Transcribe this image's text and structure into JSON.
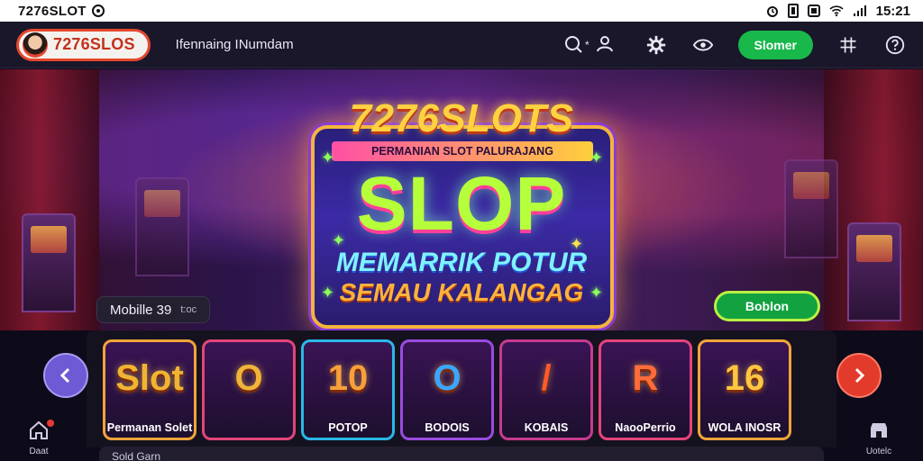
{
  "status_bar": {
    "app_title": "7276SLOT",
    "icons": [
      "alarm-icon",
      "battery-icon",
      "app-icon",
      "wifi-icon",
      "signal-icon"
    ],
    "time": "15:21"
  },
  "header": {
    "brand": "7276SLOS",
    "subtitle": "Ifennaing INumdam",
    "action_button": "Slomer",
    "icons": [
      "search-users-icon",
      "settings-icon",
      "eye-icon",
      "grid-icon",
      "help-icon"
    ]
  },
  "hero": {
    "sign_brand": "7276SLOTS",
    "sign_ribbon": "PERMANIAN SLOT PALURAJANG",
    "sign_main": "SLOP",
    "sign_line1": "MEMARRIK POTUR",
    "sign_line2": "SEMAU KALANGAG",
    "chip_label": "Mobille 39",
    "chip_sub": "t:oc",
    "cta_label": "Boblon"
  },
  "games": [
    {
      "label": "Permanan Solet",
      "art": "Slot",
      "accent": "#f1b431"
    },
    {
      "label": "",
      "art": "O",
      "accent": "#f0b43a"
    },
    {
      "label": "POTOP",
      "art": "10",
      "accent": "#f6a03b"
    },
    {
      "label": "BODOIS",
      "art": "O",
      "accent": "#3aa6ff"
    },
    {
      "label": "KOBAIS",
      "art": "/",
      "accent": "#ff5a2b"
    },
    {
      "label": "NaooPerrio",
      "art": "R",
      "accent": "#ff6b3a"
    },
    {
      "label": "WOLA INOSR",
      "art": "16",
      "accent": "#ffc640"
    }
  ],
  "bottom_nav": {
    "left_label": "Daat",
    "right_label": "Uotelc",
    "search_text": "Sold Garn"
  },
  "colors": {
    "brand_red": "#c4311c",
    "green_cta": "#18b84a",
    "next_arrow": "#e23b2b",
    "prev_arrow": "#6f5ad6"
  }
}
